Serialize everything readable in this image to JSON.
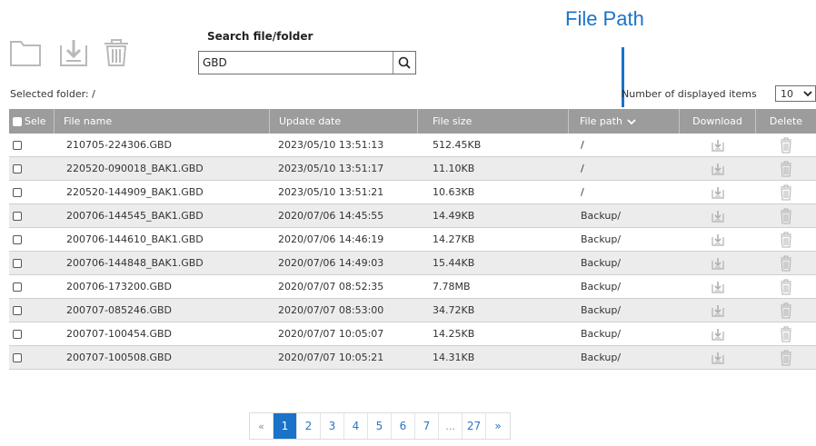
{
  "toolbar": {
    "new_folder_icon": "folder-icon",
    "download_icon": "download-icon",
    "delete_icon": "trash-icon"
  },
  "search": {
    "label": "Search file/folder",
    "value": "GBD",
    "button_icon": "search-icon"
  },
  "annotation": {
    "text": "File Path",
    "color": "#1a73c8"
  },
  "selected_folder": "Selected folder: /",
  "display_items": {
    "label": "Number of displayed items",
    "value": "10"
  },
  "table": {
    "headers": {
      "select": "Sele",
      "file_name": "File name",
      "update_date": "Update date",
      "file_size": "File size",
      "file_path": "File path",
      "download": "Download",
      "delete": "Delete"
    },
    "rows": [
      {
        "name": "210705-224306.GBD",
        "date": "2023/05/10 13:51:13",
        "size": "512.45KB",
        "path": "/"
      },
      {
        "name": "220520-090018_BAK1.GBD",
        "date": "2023/05/10 13:51:17",
        "size": "11.10KB",
        "path": "/"
      },
      {
        "name": "220520-144909_BAK1.GBD",
        "date": "2023/05/10 13:51:21",
        "size": "10.63KB",
        "path": "/"
      },
      {
        "name": "200706-144545_BAK1.GBD",
        "date": "2020/07/06 14:45:55",
        "size": "14.49KB",
        "path": "Backup/"
      },
      {
        "name": "200706-144610_BAK1.GBD",
        "date": "2020/07/06 14:46:19",
        "size": "14.27KB",
        "path": "Backup/"
      },
      {
        "name": "200706-144848_BAK1.GBD",
        "date": "2020/07/06 14:49:03",
        "size": "15.44KB",
        "path": "Backup/"
      },
      {
        "name": "200706-173200.GBD",
        "date": "2020/07/07 08:52:35",
        "size": "7.78MB",
        "path": "Backup/"
      },
      {
        "name": "200707-085246.GBD",
        "date": "2020/07/07 08:53:00",
        "size": "34.72KB",
        "path": "Backup/"
      },
      {
        "name": "200707-100454.GBD",
        "date": "2020/07/07 10:05:07",
        "size": "14.25KB",
        "path": "Backup/"
      },
      {
        "name": "200707-100508.GBD",
        "date": "2020/07/07 10:05:21",
        "size": "14.31KB",
        "path": "Backup/"
      }
    ]
  },
  "pagination": {
    "prev": "«",
    "pages": [
      "1",
      "2",
      "3",
      "4",
      "5",
      "6",
      "7",
      "...",
      "27"
    ],
    "next": "»",
    "active": "1"
  },
  "colors": {
    "accent": "#1a73c8",
    "header_bg": "#9c9c9c",
    "row_alt": "#ececec"
  }
}
